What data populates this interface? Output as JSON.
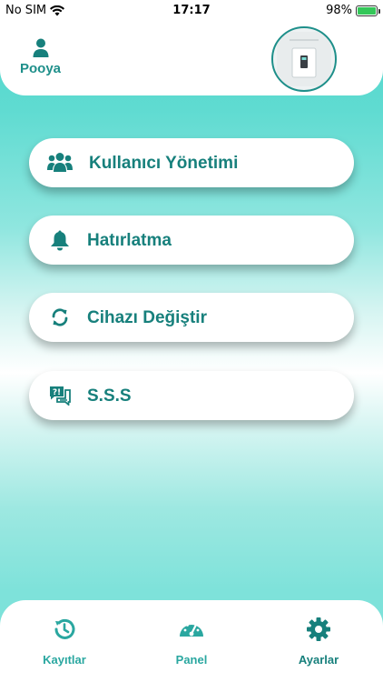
{
  "status_bar": {
    "carrier": "No SIM",
    "time": "17:17",
    "battery": "98%"
  },
  "header": {
    "user_name": "Pooya"
  },
  "menu": [
    {
      "label": "Kullanıcı Yönetimi",
      "icon": "users-icon"
    },
    {
      "label": "Hatırlatma",
      "icon": "bell-icon"
    },
    {
      "label": "Cihazı Değiştir",
      "icon": "refresh-icon"
    },
    {
      "label": "S.S.S",
      "icon": "faq-icon"
    }
  ],
  "tabs": [
    {
      "label": "Kayıtlar",
      "icon": "history-icon"
    },
    {
      "label": "Panel",
      "icon": "gauge-icon"
    },
    {
      "label": "Ayarlar",
      "icon": "gear-icon",
      "active": true
    }
  ],
  "colors": {
    "accent": "#17807c",
    "tab_label": "#2aa7a0",
    "background_top": "#4fd6cc",
    "battery_fill": "#34c759"
  }
}
